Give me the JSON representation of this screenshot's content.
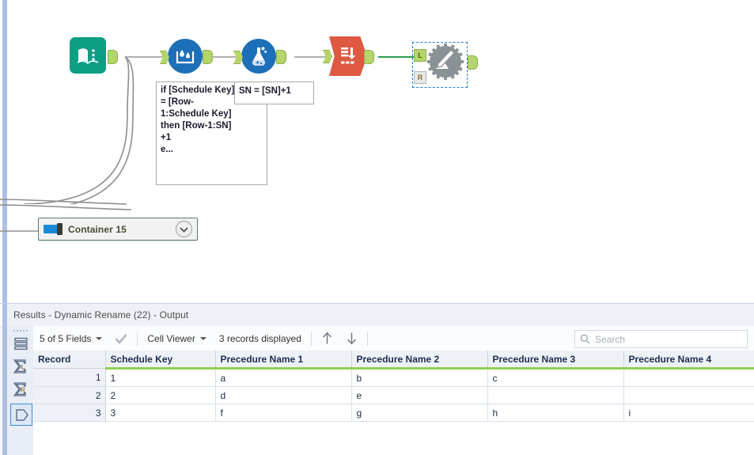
{
  "canvas": {
    "nodes": [
      {
        "id": "input-data",
        "icon": "book-icon",
        "tooltip": ""
      },
      {
        "id": "data-cleansing",
        "icon": "water-droplet-icon",
        "tooltip": ""
      },
      {
        "id": "multi-row-formula",
        "icon": "flask-icon",
        "tooltip": ""
      },
      {
        "id": "cross-tab",
        "icon": "crosstab-icon",
        "tooltip": ""
      },
      {
        "id": "dynamic-rename",
        "icon": "gear-pencil-icon",
        "tooltip": "",
        "selected": true
      }
    ],
    "annotations": [
      {
        "id": "formula-annotation",
        "text": "if [Schedule Key]\n= [Row-\n1:Schedule Key]\nthen [Row-1:SN]\n+1\ne..."
      },
      {
        "id": "sn-annotation",
        "text": "SN = [SN]+1"
      }
    ],
    "anchor_labels": {
      "left": "L",
      "right": "R"
    },
    "container": {
      "label": "Container 15",
      "chevron": "chevron-down-icon"
    }
  },
  "results": {
    "title": "Results - Dynamic Rename (22) - Output",
    "sidebar": {
      "items": [
        {
          "id": "messages-icon",
          "glyph": "rows"
        },
        {
          "id": "sum-left-icon",
          "glyph": "ΣL"
        },
        {
          "id": "sum-right-icon",
          "glyph": "ΣR"
        },
        {
          "id": "output-anchor-icon",
          "glyph": "anchor",
          "selected": true
        }
      ]
    },
    "toolbar": {
      "fields_label": "5 of 5 Fields",
      "check_icon": "check-icon",
      "view_label": "Cell Viewer",
      "records_label": "3 records displayed",
      "up_icon": "arrow-up-icon",
      "down_icon": "arrow-down-icon",
      "search_icon": "search-icon",
      "search_placeholder": "Search",
      "search_value": ""
    },
    "table": {
      "columns": [
        "Record",
        "Schedule Key",
        "Precedure Name 1",
        "Precedure Name 2",
        "Precedure Name 3",
        "Precedure Name 4"
      ],
      "rows": [
        [
          "1",
          "1",
          "a",
          "b",
          "c",
          ""
        ],
        [
          "2",
          "2",
          "d",
          "e",
          "",
          ""
        ],
        [
          "3",
          "3",
          "f",
          "g",
          "h",
          "i"
        ]
      ]
    }
  },
  "colors": {
    "input_tool": "#0b9e84",
    "blue_tool": "#1d6fb8",
    "crosstab_tool": "#de5842",
    "gear_tool": "#8b9296",
    "anchor_green": "#b5d56a",
    "wire_green": "#2e9b4f",
    "header_underline": "#8fd14f",
    "rail_blue": "#adc0e3"
  }
}
